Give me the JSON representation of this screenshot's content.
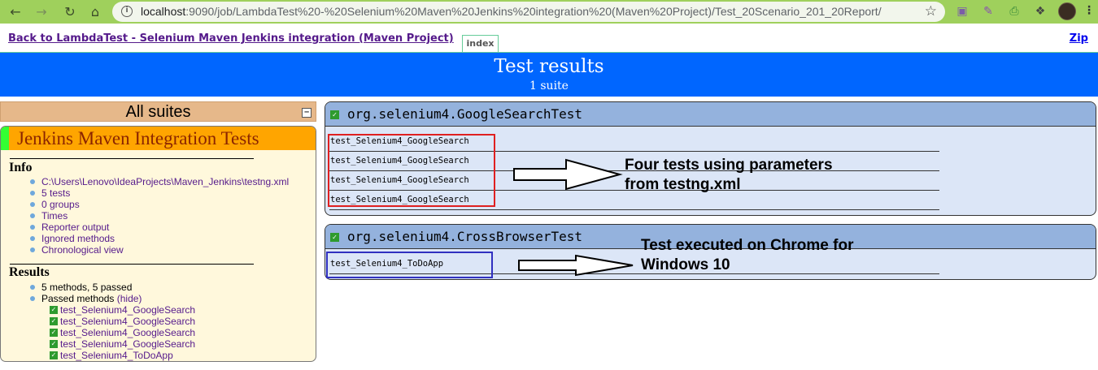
{
  "browser": {
    "url_host": "localhost",
    "url_path": ":9090/job/LambdaTest%20-%20Selenium%20Maven%20Jenkins%20integration%20(Maven%20Project)/Test_20Scenario_201_20Report/"
  },
  "header": {
    "back_link": "Back to LambdaTest - Selenium Maven Jenkins integration (Maven Project)",
    "index_tab": "index",
    "zip_link": "Zip",
    "title": "Test results",
    "subtitle": "1 suite"
  },
  "left": {
    "all_suites": "All suites",
    "suite_name": "Jenkins Maven Integration Tests",
    "info_title": "Info",
    "info_items": [
      "C:\\Users\\Lenovo\\IdeaProjects\\Maven_Jenkins\\testng.xml",
      "5 tests",
      "0 groups",
      "Times",
      "Reporter output",
      "Ignored methods",
      "Chronological view"
    ],
    "results_title": "Results",
    "results_summary": "5 methods, 5 passed",
    "passed_label": "Passed methods",
    "hide_label": "(hide)",
    "passed_methods": [
      "test_Selenium4_GoogleSearch",
      "test_Selenium4_GoogleSearch",
      "test_Selenium4_GoogleSearch",
      "test_Selenium4_GoogleSearch",
      "test_Selenium4_ToDoApp"
    ]
  },
  "classes": [
    {
      "name": "org.selenium4.GoogleSearchTest",
      "methods": [
        "test_Selenium4_GoogleSearch",
        "test_Selenium4_GoogleSearch",
        "test_Selenium4_GoogleSearch",
        "test_Selenium4_GoogleSearch"
      ]
    },
    {
      "name": "org.selenium4.CrossBrowserTest",
      "methods": [
        "test_Selenium4_ToDoApp"
      ]
    }
  ],
  "annotations": {
    "first_line1": "Four tests using parameters",
    "first_line2": "from testng.xml",
    "second_line1": "Test executed on Chrome for",
    "second_line2": "Windows 10"
  },
  "colors": {
    "banner": "#0066ff",
    "suite_header": "#ffa500",
    "class_header": "#94b2dd",
    "highlight_red": "#e02020",
    "highlight_blue": "#3030c0"
  }
}
